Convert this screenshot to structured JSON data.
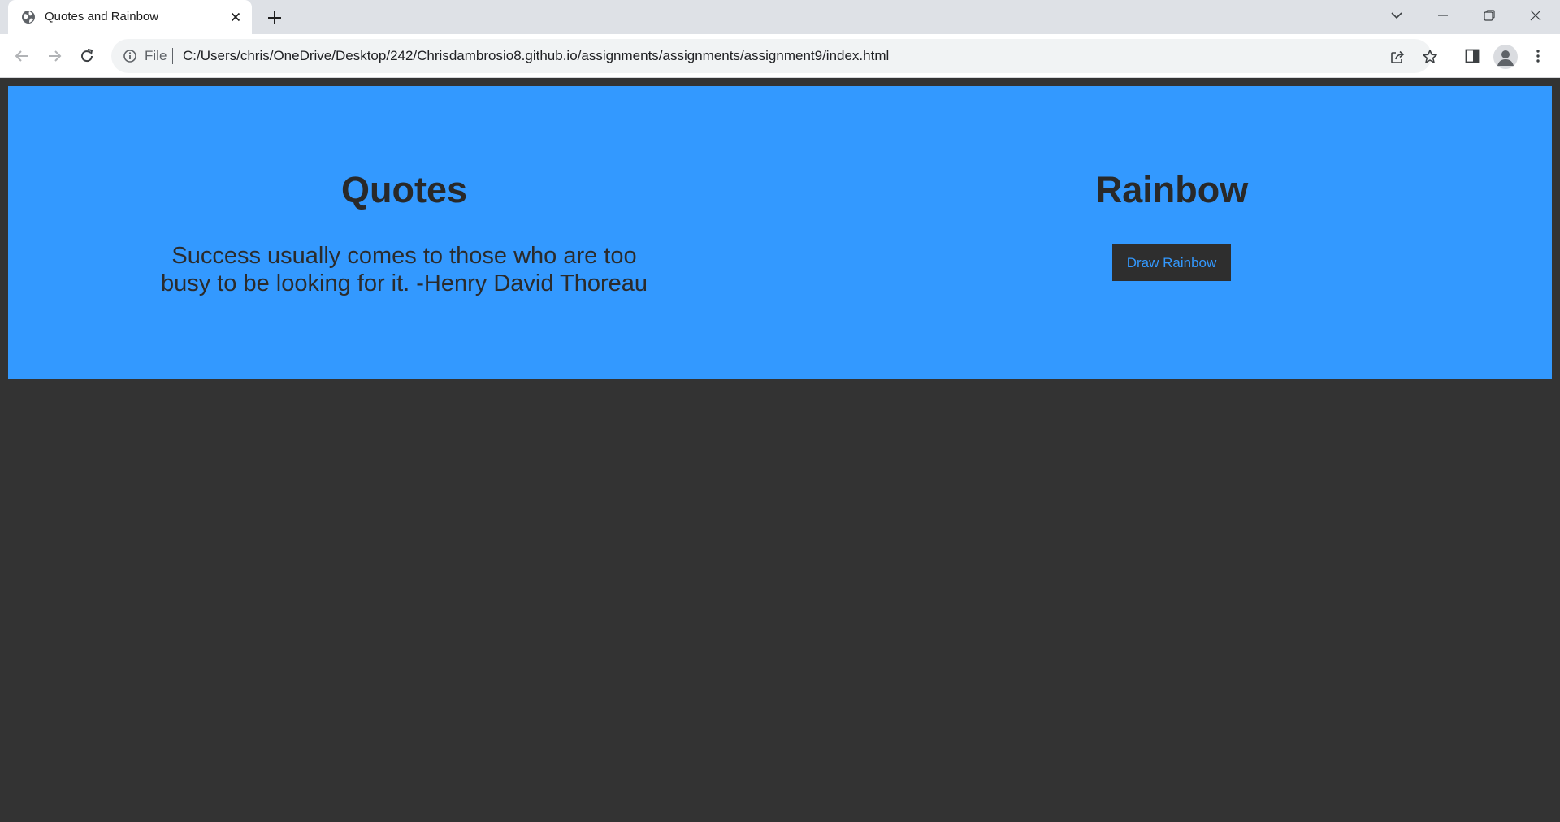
{
  "browser": {
    "tab_title": "Quotes and Rainbow",
    "url_scheme_label": "File",
    "url": "C:/Users/chris/OneDrive/Desktop/242/Chrisdambrosio8.github.io/assignments/assignments/assignment9/index.html"
  },
  "page": {
    "quotes": {
      "heading": "Quotes",
      "text": "Success usually comes to those who are too busy to be looking for it. -Henry David Thoreau"
    },
    "rainbow": {
      "heading": "Rainbow",
      "button_label": "Draw Rainbow"
    },
    "colors": {
      "banner": "#3399ff",
      "page_background": "#333333",
      "button_background": "#2e2e2e",
      "button_text": "#3399ff"
    }
  },
  "icons": {
    "favicon": "globe-icon",
    "tab_close": "close-icon",
    "new_tab": "plus-icon",
    "tab_search": "chevron-down-icon",
    "minimize": "minimize-icon",
    "restore": "restore-icon",
    "close_window": "close-icon",
    "back": "arrow-left-icon",
    "forward": "arrow-right-icon",
    "reload": "reload-icon",
    "site_info": "info-icon",
    "share": "share-icon",
    "bookmark": "star-icon",
    "side_panel": "side-panel-icon",
    "profile": "profile-icon",
    "menu": "more-vertical-icon"
  }
}
